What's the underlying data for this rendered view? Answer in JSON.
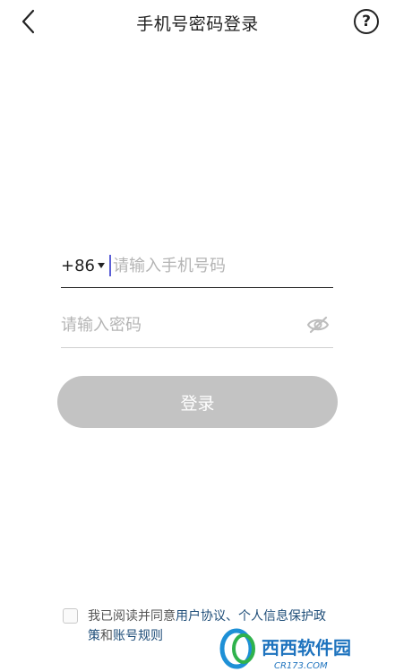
{
  "header": {
    "title": "手机号密码登录",
    "help_glyph": "?"
  },
  "phone": {
    "country_code": "+86",
    "placeholder": "请输入手机号码",
    "value": ""
  },
  "password": {
    "placeholder": "请输入密码",
    "value": ""
  },
  "login_button": {
    "label": "登录",
    "enabled": false
  },
  "agreement": {
    "checked": false,
    "prefix": "我已阅读并同意",
    "user_agreement": "用户协议",
    "separator": "、",
    "privacy": "个人信息保护政策",
    "conjunction": "和",
    "account_rules": "账号规则"
  },
  "watermark": {
    "text": "西西软件园",
    "domain": "CR173.COM"
  },
  "colors": {
    "link": "#1f4e79",
    "button_disabled": "#c3c3c3",
    "cursor": "#5b5fd6",
    "placeholder": "#b4b4b4"
  },
  "icons": {
    "back": "chevron-left-icon",
    "help": "question-circle-icon",
    "country_dropdown": "caret-down-icon",
    "password_visibility": "eye-off-icon"
  }
}
